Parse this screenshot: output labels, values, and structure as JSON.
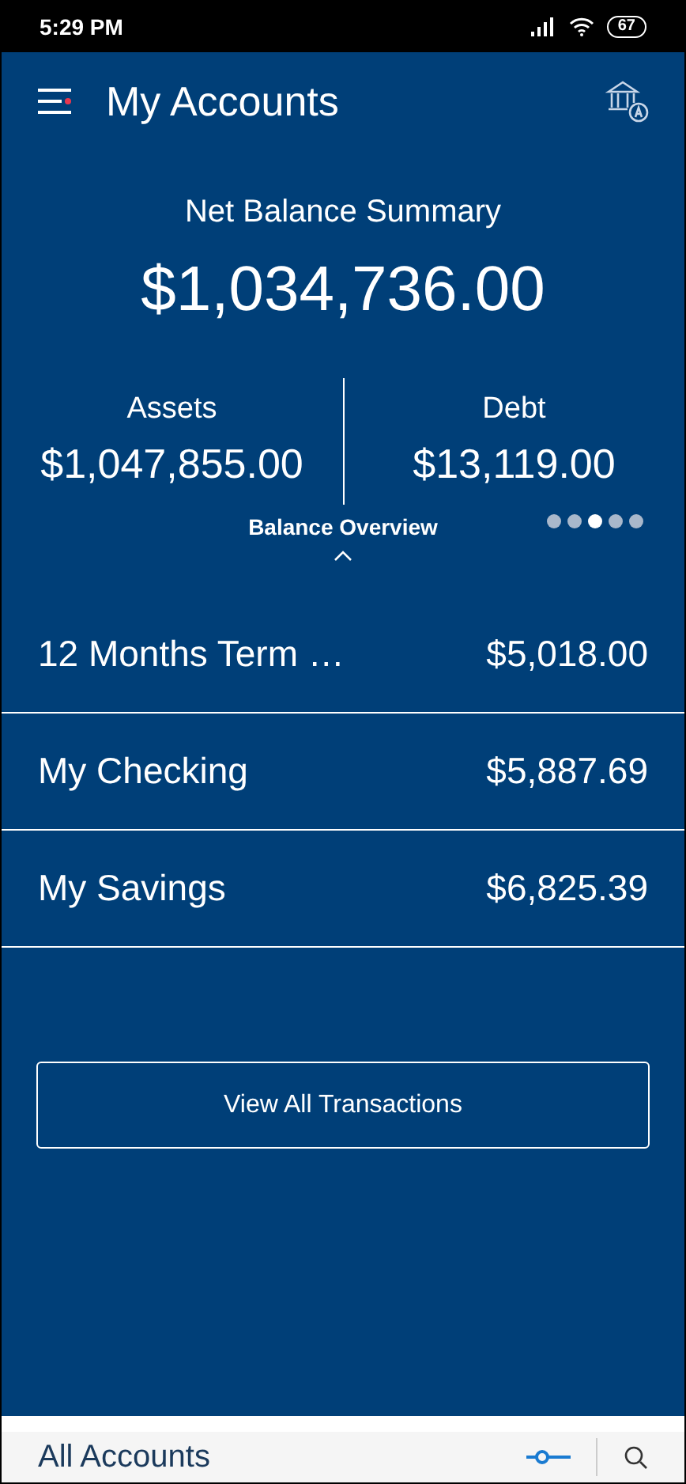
{
  "status_bar": {
    "time": "5:29 PM",
    "battery": "67"
  },
  "header": {
    "title": "My Accounts"
  },
  "summary": {
    "title": "Net Balance Summary",
    "amount": "$1,034,736.00"
  },
  "balances": [
    {
      "label": "Assets",
      "amount": "$1,047,855.00"
    },
    {
      "label": "Debt",
      "amount": "$13,119.00"
    }
  ],
  "carousel": {
    "caption": "Balance Overview",
    "pages": [
      {
        "selected": false
      },
      {
        "selected": false
      },
      {
        "selected": true
      },
      {
        "selected": false
      },
      {
        "selected": false
      }
    ]
  },
  "accounts": [
    {
      "name": "12 Months Term …",
      "balance": "$5,018.00"
    },
    {
      "name": "My Checking",
      "balance": "$5,887.69"
    },
    {
      "name": "My Savings",
      "balance": "$6,825.39"
    }
  ],
  "action": {
    "label": "View All Transactions"
  },
  "bottom_panel": {
    "title": "All Accounts"
  }
}
